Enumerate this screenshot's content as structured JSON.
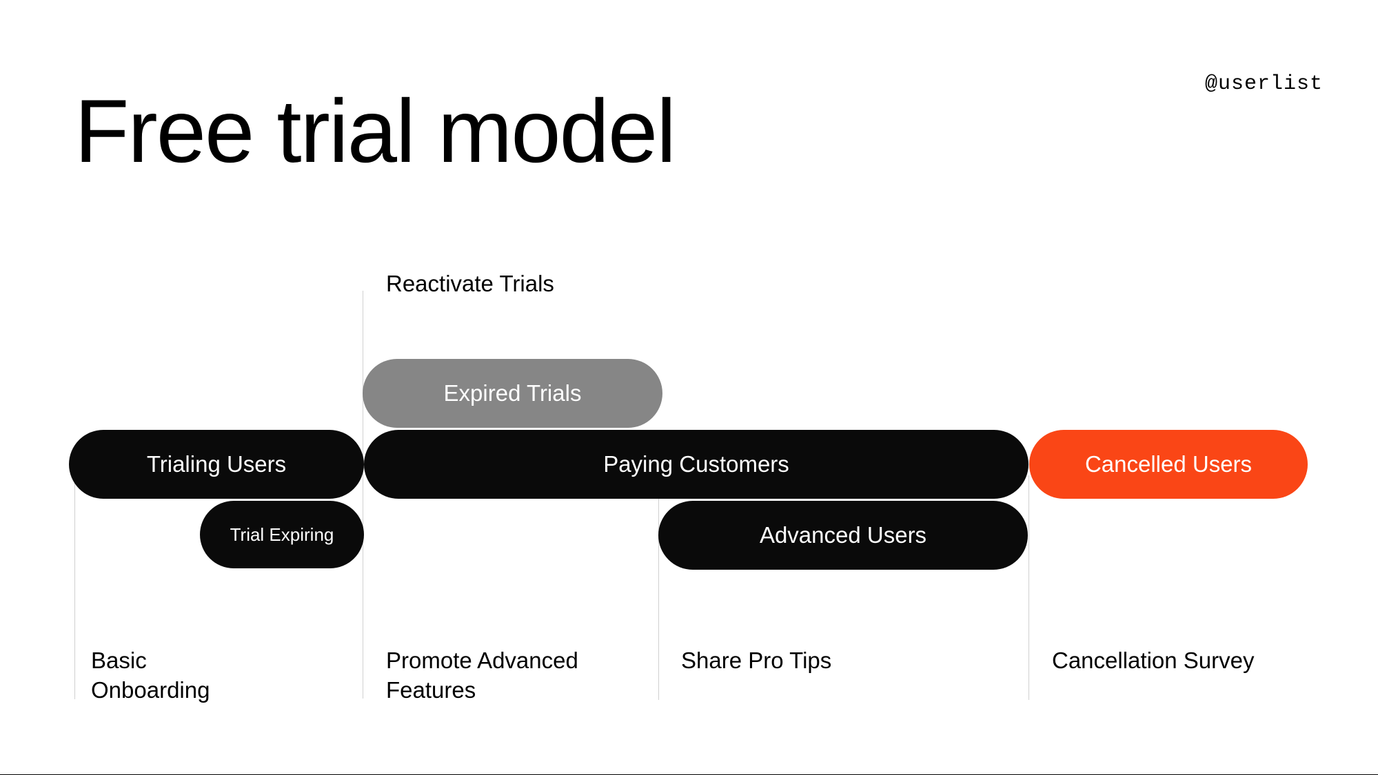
{
  "title": "Free trial model",
  "handle": "@userlist",
  "labels": {
    "top": "Reactivate Trials",
    "bottom": [
      "Basic Onboarding",
      "Promote Advanced Features",
      "Share Pro Tips",
      "Cancellation Survey"
    ]
  },
  "pills": {
    "expired_trials": "Expired Trials",
    "trialing_users": "Trialing Users",
    "paying_customers": "Paying Customers",
    "cancelled_users": "Cancelled Users",
    "trial_expiring": "Trial Expiring",
    "advanced_users": "Advanced Users"
  }
}
